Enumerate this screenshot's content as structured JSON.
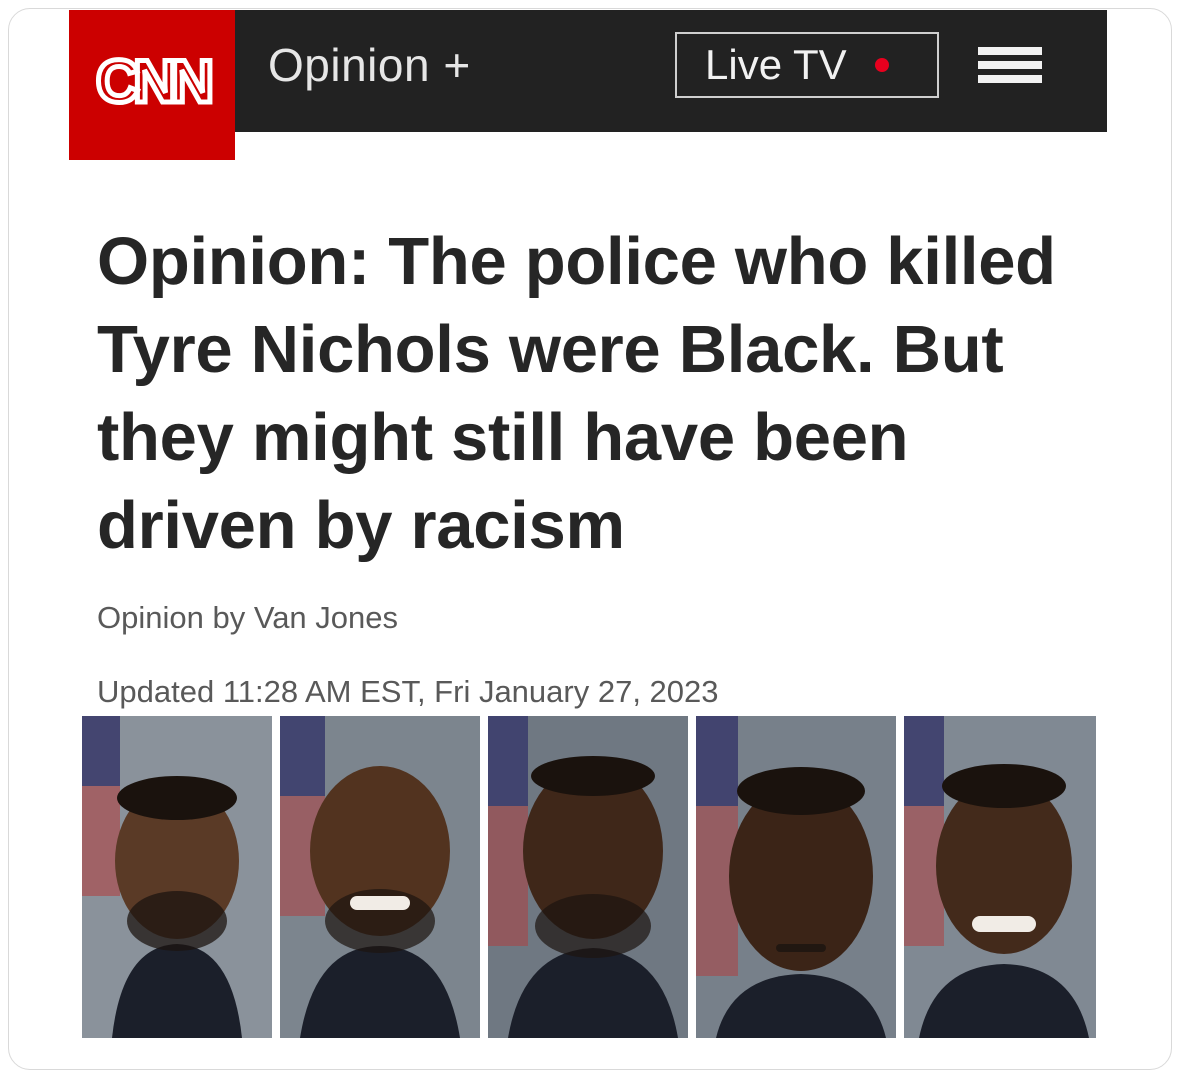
{
  "header": {
    "logo_text": "CNN",
    "section_label": "Opinion +",
    "live_tv_label": "Live TV",
    "menu_icon": "hamburger-menu-icon",
    "colors": {
      "brand_red": "#cc0000",
      "nav_bg": "#222222",
      "live_dot": "#e8001e"
    }
  },
  "article": {
    "headline": "Opinion: The police who killed Tyre Nichols were Black. But they might still have been driven by racism",
    "byline": "Opinion by Van Jones",
    "updated": "Updated 11:28 AM EST, Fri January 27, 2023"
  },
  "photos": [
    {
      "name": "officer-photo-1",
      "skin": "#5a3a26",
      "bg": "#8a929b"
    },
    {
      "name": "officer-photo-2",
      "skin": "#52331f",
      "bg": "#7c858e"
    },
    {
      "name": "officer-photo-3",
      "skin": "#3f2719",
      "bg": "#6f7882"
    },
    {
      "name": "officer-photo-4",
      "skin": "#3b2417",
      "bg": "#77808a"
    },
    {
      "name": "officer-photo-5",
      "skin": "#432a1b",
      "bg": "#808993"
    }
  ]
}
